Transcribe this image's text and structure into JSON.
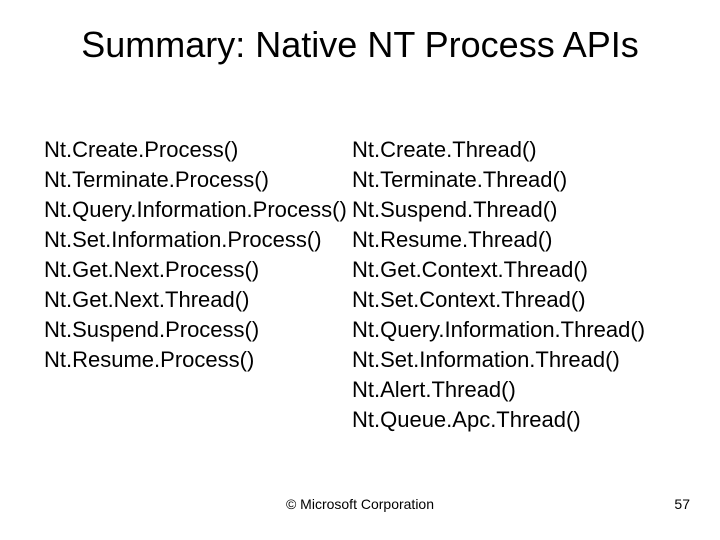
{
  "title": "Summary: Native NT Process APIs",
  "left_items": [
    "Nt.Create.Process()",
    "Nt.Terminate.Process()",
    "Nt.Query.Information.Process()",
    "Nt.Set.Information.Process()",
    "Nt.Get.Next.Process()",
    "Nt.Get.Next.Thread()",
    "Nt.Suspend.Process()",
    "Nt.Resume.Process()"
  ],
  "right_items": [
    "Nt.Create.Thread()",
    "Nt.Terminate.Thread()",
    "Nt.Suspend.Thread()",
    "Nt.Resume.Thread()",
    "Nt.Get.Context.Thread()",
    "Nt.Set.Context.Thread()",
    "Nt.Query.Information.Thread()",
    "Nt.Set.Information.Thread()",
    "Nt.Alert.Thread()",
    "Nt.Queue.Apc.Thread()"
  ],
  "footer_center": "© Microsoft Corporation",
  "footer_right": "57"
}
